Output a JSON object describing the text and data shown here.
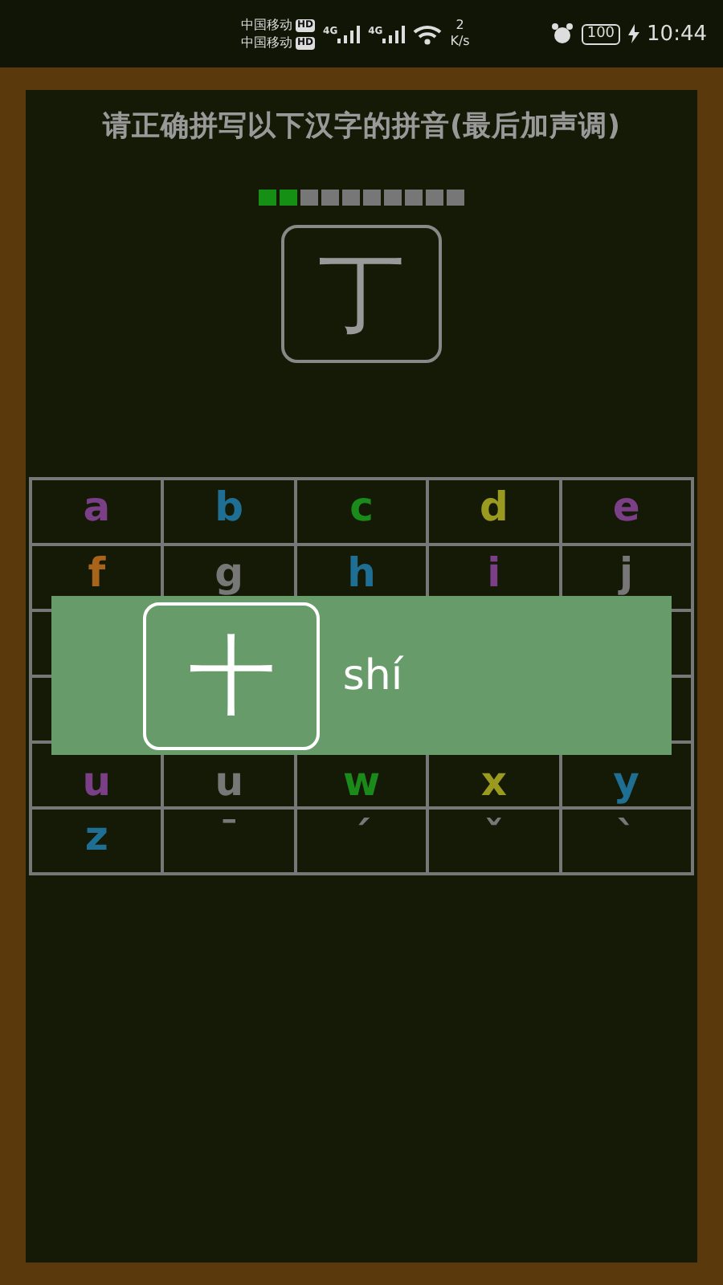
{
  "status_bar": {
    "carriers": [
      {
        "name": "中国移动",
        "badge": "HD",
        "network": "4G"
      },
      {
        "name": "中国移动",
        "badge": "HD",
        "network": "4G"
      }
    ],
    "speed_value": "2",
    "speed_unit": "K/s",
    "battery": "100",
    "time": "10:44"
  },
  "instruction": "请正确拼写以下汉字的拼音(最后加声调)",
  "progress": [
    {
      "done": true
    },
    {
      "done": true
    },
    {
      "done": false
    },
    {
      "done": false
    },
    {
      "done": false
    },
    {
      "done": false
    },
    {
      "done": false
    },
    {
      "done": false
    },
    {
      "done": false
    },
    {
      "done": false
    }
  ],
  "question_char": "丁",
  "keyboard": [
    {
      "kind": "letters",
      "keys": [
        {
          "label": "a",
          "color": "#7a3f86"
        },
        {
          "label": "b",
          "color": "#1f6f94"
        },
        {
          "label": "c",
          "color": "#1a8a1a"
        },
        {
          "label": "d",
          "color": "#9a9a20"
        },
        {
          "label": "e",
          "color": "#7a3f86"
        }
      ]
    },
    {
      "kind": "letters",
      "keys": [
        {
          "label": "f",
          "color": "#a8641a"
        },
        {
          "label": "g",
          "color": "#777777"
        },
        {
          "label": "h",
          "color": "#1f6f94"
        },
        {
          "label": "i",
          "color": "#7a3f86"
        },
        {
          "label": "j",
          "color": "#777777"
        }
      ]
    },
    {
      "kind": "covered"
    },
    {
      "kind": "covered"
    },
    {
      "kind": "letters",
      "keys": [
        {
          "label": "u",
          "color": "#7a3f86"
        },
        {
          "label": "u",
          "color": "#777777"
        },
        {
          "label": "w",
          "color": "#1a8a1a"
        },
        {
          "label": "x",
          "color": "#9a9a20"
        },
        {
          "label": "y",
          "color": "#1f6f94"
        }
      ]
    },
    {
      "kind": "letters",
      "keys": [
        {
          "label": "z",
          "color": "#1f6f94"
        },
        {
          "label": "ˉ",
          "color": "#777777"
        },
        {
          "label": "ˊ",
          "color": "#777777"
        },
        {
          "label": "ˇ",
          "color": "#777777"
        },
        {
          "label": "ˋ",
          "color": "#777777"
        }
      ]
    }
  ],
  "answer_popup": {
    "char": "十",
    "pinyin": "shí"
  }
}
